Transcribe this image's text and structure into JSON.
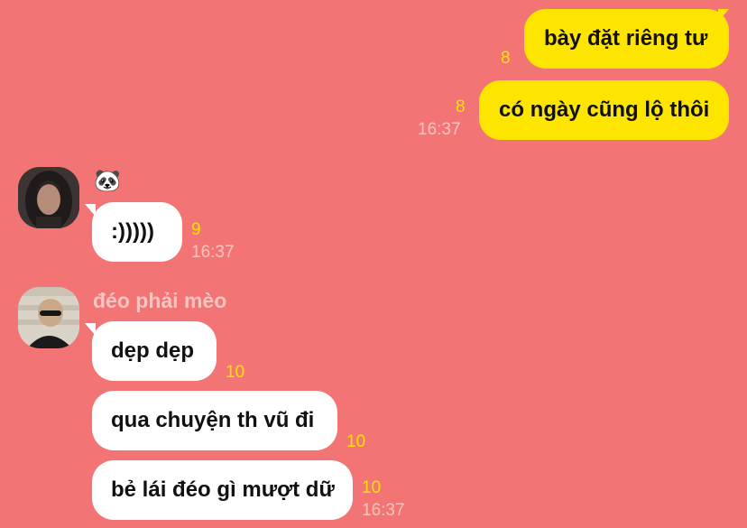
{
  "messages": {
    "out1": {
      "text": "bày đặt riêng tư",
      "unread": "8"
    },
    "out2": {
      "text": "có ngày cũng lộ thôi",
      "unread": "8",
      "time": "16:37"
    },
    "in1": {
      "sender": "🐼",
      "text": ":)))))",
      "unread": "9",
      "time": "16:37"
    },
    "in2": {
      "sender": "đéo phải mèo",
      "text": "dẹp dẹp",
      "unread": "10"
    },
    "in3": {
      "text": "qua chuyện th vũ đi",
      "unread": "10"
    },
    "in4": {
      "text": "bẻ lái đéo gì mượt dữ",
      "unread": "10",
      "time": "16:37"
    }
  },
  "colors": {
    "background": "#F27474",
    "outgoing_bubble": "#FEE500",
    "incoming_bubble": "#FFFFFF",
    "unread_count": "#FEE500",
    "timestamp": "#F9C4C0"
  },
  "icons": {
    "avatar1": "avatar-hooded-person-icon",
    "avatar2": "avatar-person-sunglasses-icon"
  }
}
